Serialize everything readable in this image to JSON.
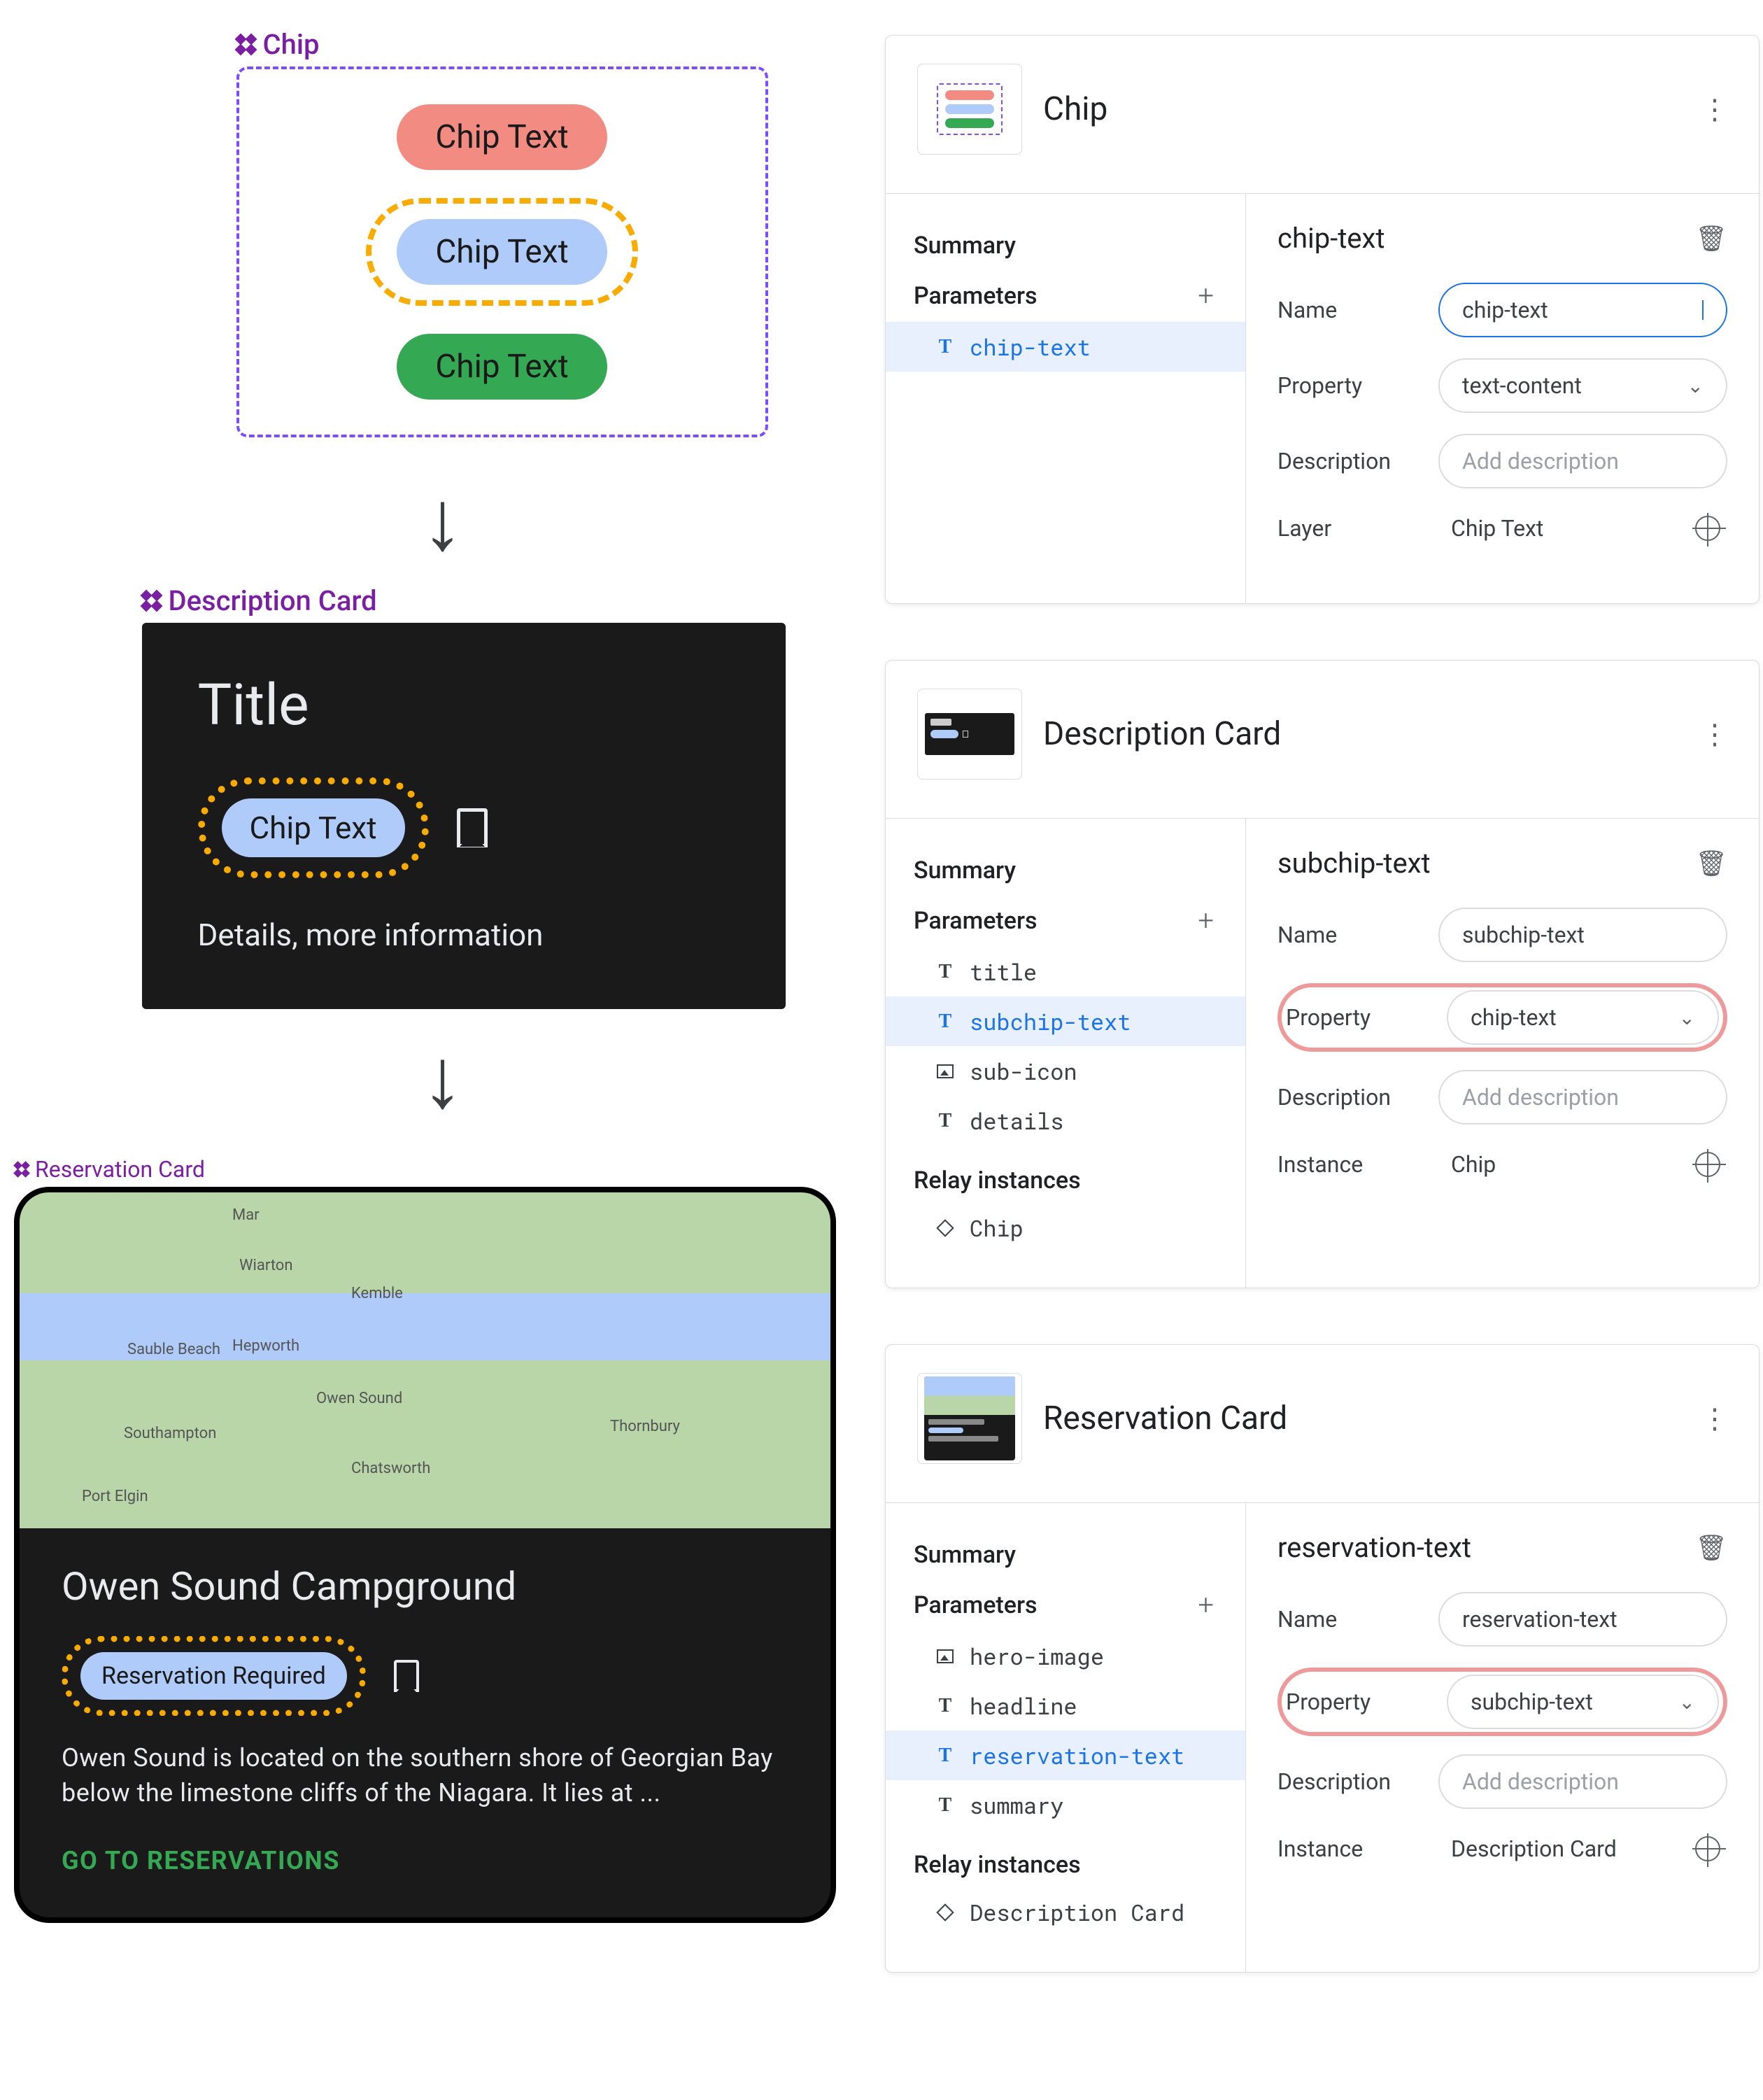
{
  "labels": {
    "chip": "Chip",
    "description_card": "Description Card",
    "reservation_card": "Reservation Card"
  },
  "chip_block": {
    "items": [
      "Chip Text",
      "Chip Text",
      "Chip Text"
    ]
  },
  "desc_card": {
    "title": "Title",
    "chip": "Chip Text",
    "details": "Details, more information"
  },
  "res_card": {
    "headline": "Owen Sound Campground",
    "chip": "Reservation Required",
    "summary": "Owen Sound is located on the southern shore of Georgian Bay below the limestone cliffs of the Niagara. It lies at ...",
    "cta": "GO TO RESERVATIONS",
    "map_labels": [
      "Mar",
      "Wiarton",
      "Kemble",
      "Sauble Beach",
      "Hepworth",
      "Owen Sound",
      "Southampton",
      "Chatsworth",
      "Port Elgin",
      "Thornbury"
    ]
  },
  "panels": {
    "summary_label": "Summary",
    "parameters_label": "Parameters",
    "relay_label": "Relay instances",
    "name_label": "Name",
    "property_label": "Property",
    "description_label": "Description",
    "description_placeholder": "Add description",
    "layer_label": "Layer",
    "instance_label": "Instance"
  },
  "panel_chip": {
    "title": "Chip",
    "params": [
      {
        "icon": "T",
        "name": "chip-text",
        "active": true
      }
    ],
    "detail_title": "chip-text",
    "name_value": "chip-text",
    "property_value": "text-content",
    "layer_value": "Chip Text"
  },
  "panel_desc": {
    "title": "Description Card",
    "params": [
      {
        "icon": "T",
        "name": "title"
      },
      {
        "icon": "T",
        "name": "subchip-text",
        "active": true
      },
      {
        "icon": "img",
        "name": "sub-icon"
      },
      {
        "icon": "T",
        "name": "details"
      }
    ],
    "relay": [
      {
        "icon": "dia",
        "name": "Chip"
      }
    ],
    "detail_title": "subchip-text",
    "name_value": "subchip-text",
    "property_value": "chip-text",
    "instance_value": "Chip"
  },
  "panel_res": {
    "title": "Reservation Card",
    "params": [
      {
        "icon": "img",
        "name": "hero-image"
      },
      {
        "icon": "T",
        "name": "headline"
      },
      {
        "icon": "T",
        "name": "reservation-text",
        "active": true
      },
      {
        "icon": "T",
        "name": "summary"
      }
    ],
    "relay": [
      {
        "icon": "dia",
        "name": "Description Card"
      }
    ],
    "detail_title": "reservation-text",
    "name_value": "reservation-text",
    "property_value": "subchip-text",
    "instance_value": "Description Card"
  }
}
